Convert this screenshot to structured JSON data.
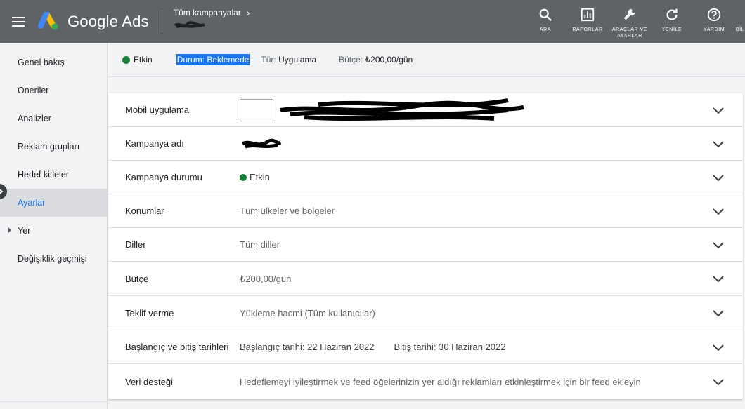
{
  "app": {
    "name": "Google Ads",
    "breadcrumb": "Tüm kampanyalar"
  },
  "toolbar": [
    {
      "key": "search",
      "label": "ARA",
      "icon": "search-icon"
    },
    {
      "key": "reports",
      "label": "RAPORLAR",
      "icon": "reports-icon"
    },
    {
      "key": "tools",
      "label": "ARAÇLAR VE AYARLAR",
      "icon": "wrench-icon"
    },
    {
      "key": "refresh",
      "label": "YENİLE",
      "icon": "refresh-icon"
    },
    {
      "key": "help",
      "label": "YARDIM",
      "icon": "help-icon"
    },
    {
      "key": "notifications",
      "label": "BİL",
      "icon": "bell-icon"
    }
  ],
  "sidebar": {
    "items": [
      {
        "label": "Genel bakış"
      },
      {
        "label": "Öneriler"
      },
      {
        "label": "Analizler"
      },
      {
        "label": "Reklam grupları"
      },
      {
        "label": "Hedef kitleler"
      },
      {
        "label": "Ayarlar",
        "active": true
      },
      {
        "label": "Yer"
      },
      {
        "label": "Değişiklik geçmişi"
      }
    ]
  },
  "status": {
    "state": "Etkin",
    "durum_label": "Durum:",
    "durum_value": "Beklemede",
    "tur_label": "Tür:",
    "tur_value": "Uygulama",
    "butce_label": "Bütçe:",
    "butce_value": "₺200,00/gün"
  },
  "settings": {
    "mobile_app": {
      "label": "Mobil uygulama"
    },
    "campaign_name": {
      "label": "Kampanya adı"
    },
    "campaign_status": {
      "label": "Kampanya durumu",
      "value": "Etkin"
    },
    "locations": {
      "label": "Konumlar",
      "value": "Tüm ülkeler ve bölgeler"
    },
    "languages": {
      "label": "Diller",
      "value": "Tüm diller"
    },
    "budget": {
      "label": "Bütçe",
      "value": "₺200,00/gün"
    },
    "bidding": {
      "label": "Teklif verme",
      "value": "Yükleme hacmi (Tüm kullanıcılar)"
    },
    "dates": {
      "label": "Başlangıç ve bitiş tarihleri",
      "start": "Başlangıç tarihi: 22 Haziran 2022",
      "end": "Bitiş tarihi: 30 Haziran 2022"
    },
    "data_feed": {
      "label": "Veri desteği",
      "value": "Hedeflemeyi iyileştirmek ve feed öğelerinizin yer aldığı reklamları etkinleştirmek için bir feed ekleyin"
    }
  },
  "colors": {
    "topbar": "#5f6368",
    "accent": "#1a73e8",
    "status_green": "#188038"
  }
}
